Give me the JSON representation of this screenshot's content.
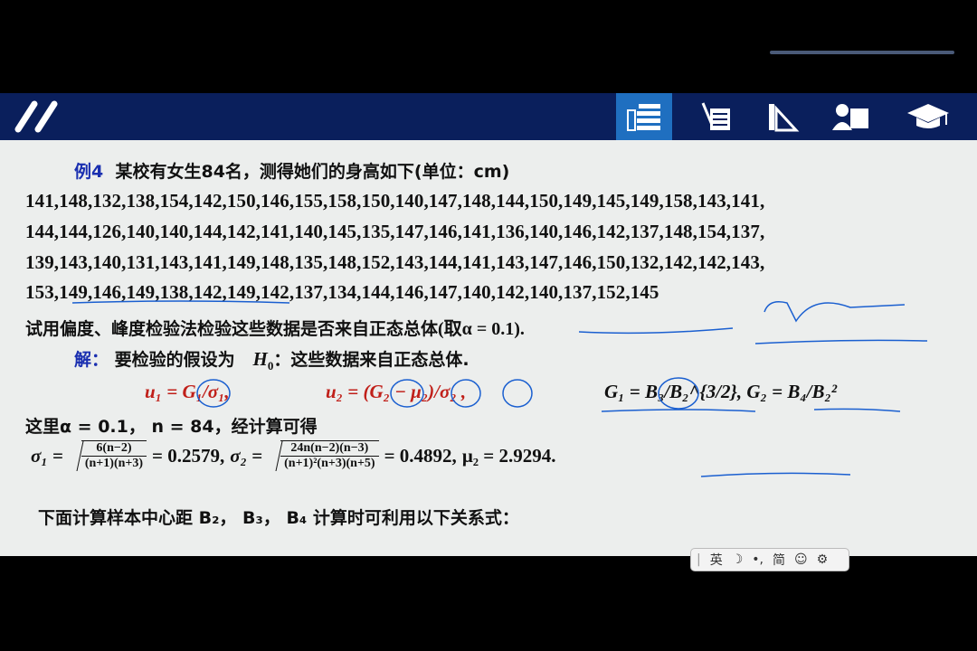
{
  "navbar": {
    "icons": [
      "books-icon",
      "notes-pencil-icon",
      "triangle-ruler-icon",
      "teacher-board-icon",
      "graduation-cap-icon"
    ],
    "active_index": 0,
    "colors": {
      "bar": "#0a1f5c",
      "active": "#1f6fc0"
    }
  },
  "slide": {
    "example_label": "例4",
    "title": "某校有女生84名，测得她们的身高如下(单位：cm)",
    "data_rows": [
      "141,148,132,138,154,142,150,146,155,158,150,140,147,148,144,150,149,145,149,158,143,141,",
      "144,144,126,140,140,144,142,141,140,145,135,147,146,141,136,140,146,142,137,148,154,137,",
      "139,143,140,131,143,141,149,148,135,148,152,143,144,141,143,147,146,150,132,142,142,143,",
      "153,149,146,149,138,142,149,142,137,134,144,146,147,140,142,140,137,152,145"
    ],
    "question": "试用偏度、峰度检验法检验这些数据是否来自正态总体",
    "question_alpha": "(取α = 0.1).",
    "solution_label": "解：",
    "hypothesis_prefix": "要检验的假设为",
    "hypothesis_h0": "H",
    "hypothesis_h0_sub": "0",
    "hypothesis_text": "：这些数据来自正态总体.",
    "formula_u1": "u₁ = G₁/σ₁,",
    "formula_u2": "u₂ = (G₂ − μ₂)/σ₂ ,",
    "formula_g": "G₁ = B₃/B₂^{3/2}, G₂ = B₄/B₂²",
    "here_text": "这里α = 0.1， n = 84，经计算可得",
    "sigma1_lhs": "σ₁ =",
    "sigma1_num": "6(n−2)",
    "sigma1_den": "(n+1)(n+3)",
    "sigma1_val": "= 0.2579,",
    "sigma2_lhs": "σ₂ =",
    "sigma2_num": "24n(n−2)(n−3)",
    "sigma2_den": "(n+1)²(n+3)(n+5)",
    "sigma2_val": "= 0.4892,",
    "mu2": "μ₂ = 2.9294.",
    "next_text": "下面计算样本中心距 B₂， B₃， B₄ 计算时可利用以下关系式："
  },
  "ime_toolbar": {
    "items": [
      "英",
      "☽",
      "•,",
      "简",
      "☺",
      "⚙"
    ]
  }
}
